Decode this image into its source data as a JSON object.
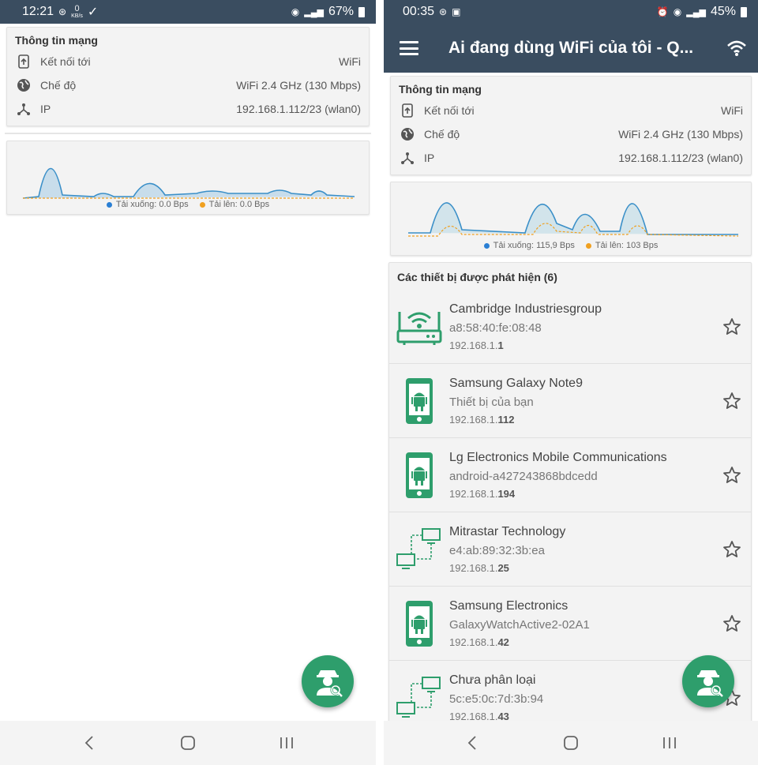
{
  "left": {
    "status": {
      "time": "12:21",
      "speed_top": "0",
      "speed_unit": "KB/s",
      "battery": "67%"
    },
    "network": {
      "title": "Thông tin mạng",
      "rows": [
        {
          "label": "Kết nối tới",
          "value": "WiFi",
          "icon": "connection-icon"
        },
        {
          "label": "Chế độ",
          "value": "WiFi 2.4 GHz (130 Mbps)",
          "icon": "globe-icon"
        },
        {
          "label": "IP",
          "value": "192.168.1.112/23 (wlan0)",
          "icon": "network-nodes-icon"
        }
      ]
    },
    "graph": {
      "download_label": "Tải xuống: 0.0 Bps",
      "upload_label": "Tải lên: 0.0 Bps"
    }
  },
  "right": {
    "status": {
      "time": "00:35",
      "battery": "45%"
    },
    "appbar": {
      "title": "Ai đang dùng WiFi của tôi - Q..."
    },
    "network": {
      "title": "Thông tin mạng",
      "rows": [
        {
          "label": "Kết nối tới",
          "value": "WiFi",
          "icon": "connection-icon"
        },
        {
          "label": "Chế độ",
          "value": "WiFi 2.4 GHz (130 Mbps)",
          "icon": "globe-icon"
        },
        {
          "label": "IP",
          "value": "192.168.1.112/23 (wlan0)",
          "icon": "network-nodes-icon"
        }
      ]
    },
    "graph": {
      "download_label": "Tải xuống: 115,9 Bps",
      "upload_label": "Tải lên: 103 Bps"
    },
    "devices": {
      "title": "Các thiết bị được phát hiện (6)",
      "items": [
        {
          "name": "Cambridge Industriesgroup",
          "sub": "a8:58:40:fe:08:48",
          "ip_prefix": "192.168.1.",
          "ip_suffix": "1",
          "icon": "router-icon"
        },
        {
          "name": "Samsung Galaxy Note9",
          "sub": "Thiết bị của bạn",
          "ip_prefix": "192.168.1.",
          "ip_suffix": "112",
          "icon": "android-phone-icon"
        },
        {
          "name": "Lg Electronics Mobile Communications",
          "sub": "android-a427243868bdcedd",
          "ip_prefix": "192.168.1.",
          "ip_suffix": "194",
          "icon": "android-phone-icon"
        },
        {
          "name": "Mitrastar Technology",
          "sub": "e4:ab:89:32:3b:ea",
          "ip_prefix": "192.168.1.",
          "ip_suffix": "25",
          "icon": "network-computers-icon"
        },
        {
          "name": "Samsung Electronics",
          "sub": "GalaxyWatchActive2-02A1",
          "ip_prefix": "192.168.1.",
          "ip_suffix": "42",
          "icon": "android-phone-icon"
        },
        {
          "name": "Chưa phân loại",
          "sub": "5c:e5:0c:7d:3b:94",
          "ip_prefix": "192.168.1.",
          "ip_suffix": "43",
          "icon": "network-computers-icon"
        }
      ]
    }
  },
  "colors": {
    "statusbar": "#3a4d60",
    "accent": "#2e9e6c",
    "download": "#2a7fd4",
    "upload": "#f0a020"
  }
}
